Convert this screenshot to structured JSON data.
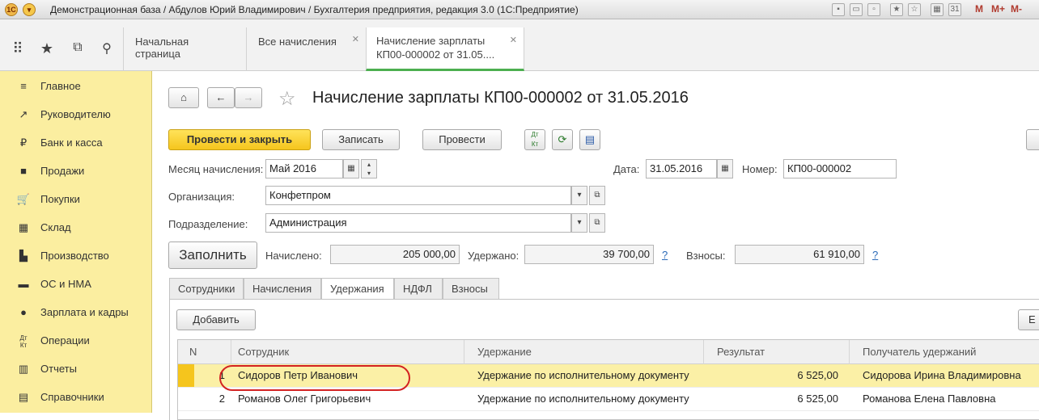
{
  "window": {
    "title": "Демонстрационная база / Абдулов Юрий Владимирович / Бухгалтерия предприятия, редакция 3.0  (1С:Предприятие)",
    "m_labels": [
      "M",
      "M+",
      "M-"
    ]
  },
  "tabs": [
    {
      "label": "Начальная страница"
    },
    {
      "label": "Все начисления"
    },
    {
      "label_line1": "Начисление зарплаты",
      "label_line2": "КП00-000002 от 31.05...."
    }
  ],
  "sidebar": {
    "items": [
      {
        "label": "Главное",
        "icon": "≡"
      },
      {
        "label": "Руководителю",
        "icon": "↗"
      },
      {
        "label": "Банк и касса",
        "icon": "₽"
      },
      {
        "label": "Продажи",
        "icon": "■"
      },
      {
        "label": "Покупки",
        "icon": "🛒"
      },
      {
        "label": "Склад",
        "icon": "▦"
      },
      {
        "label": "Производство",
        "icon": "▙"
      },
      {
        "label": "ОС и НМА",
        "icon": "▬"
      },
      {
        "label": "Зарплата и кадры",
        "icon": "●"
      },
      {
        "label": "Операции",
        "icon": "Дт Кт"
      },
      {
        "label": "Отчеты",
        "icon": "▥"
      },
      {
        "label": "Справочники",
        "icon": "▤"
      }
    ]
  },
  "doc": {
    "title": "Начисление зарплаты КП00-000002 от 31.05.2016"
  },
  "toolbar": {
    "post_close": "Провести и закрыть",
    "save": "Записать",
    "post": "Провести"
  },
  "form": {
    "month_label": "Месяц начисления:",
    "month_value": "Май 2016",
    "date_label": "Дата:",
    "date_value": "31.05.2016",
    "number_label": "Номер:",
    "number_value": "КП00-000002",
    "org_label": "Организация:",
    "org_value": "Конфетпром",
    "dept_label": "Подразделение:",
    "dept_value": "Администрация",
    "fill_button": "Заполнить",
    "accrued_label": "Начислено:",
    "accrued_value": "205 000,00",
    "withheld_label": "Удержано:",
    "withheld_value": "39 700,00",
    "contrib_label": "Взносы:",
    "contrib_value": "61 910,00",
    "help": "?"
  },
  "subtabs": [
    "Сотрудники",
    "Начисления",
    "Удержания",
    "НДФЛ",
    "Взносы"
  ],
  "table": {
    "add_button": "Добавить",
    "right_button": "Е",
    "columns": [
      "N",
      "Сотрудник",
      "Удержание",
      "Результат",
      "Получатель удержаний"
    ],
    "rows": [
      {
        "n": "1",
        "employee": "Сидоров Петр Иванович",
        "deduction": "Удержание по исполнительному документу",
        "result": "6 525,00",
        "recipient": "Сидорова Ирина Владимировна"
      },
      {
        "n": "2",
        "employee": "Романов Олег Григорьевич",
        "deduction": "Удержание по исполнительному документу",
        "result": "6 525,00",
        "recipient": "Романова Елена Павловна"
      }
    ]
  }
}
